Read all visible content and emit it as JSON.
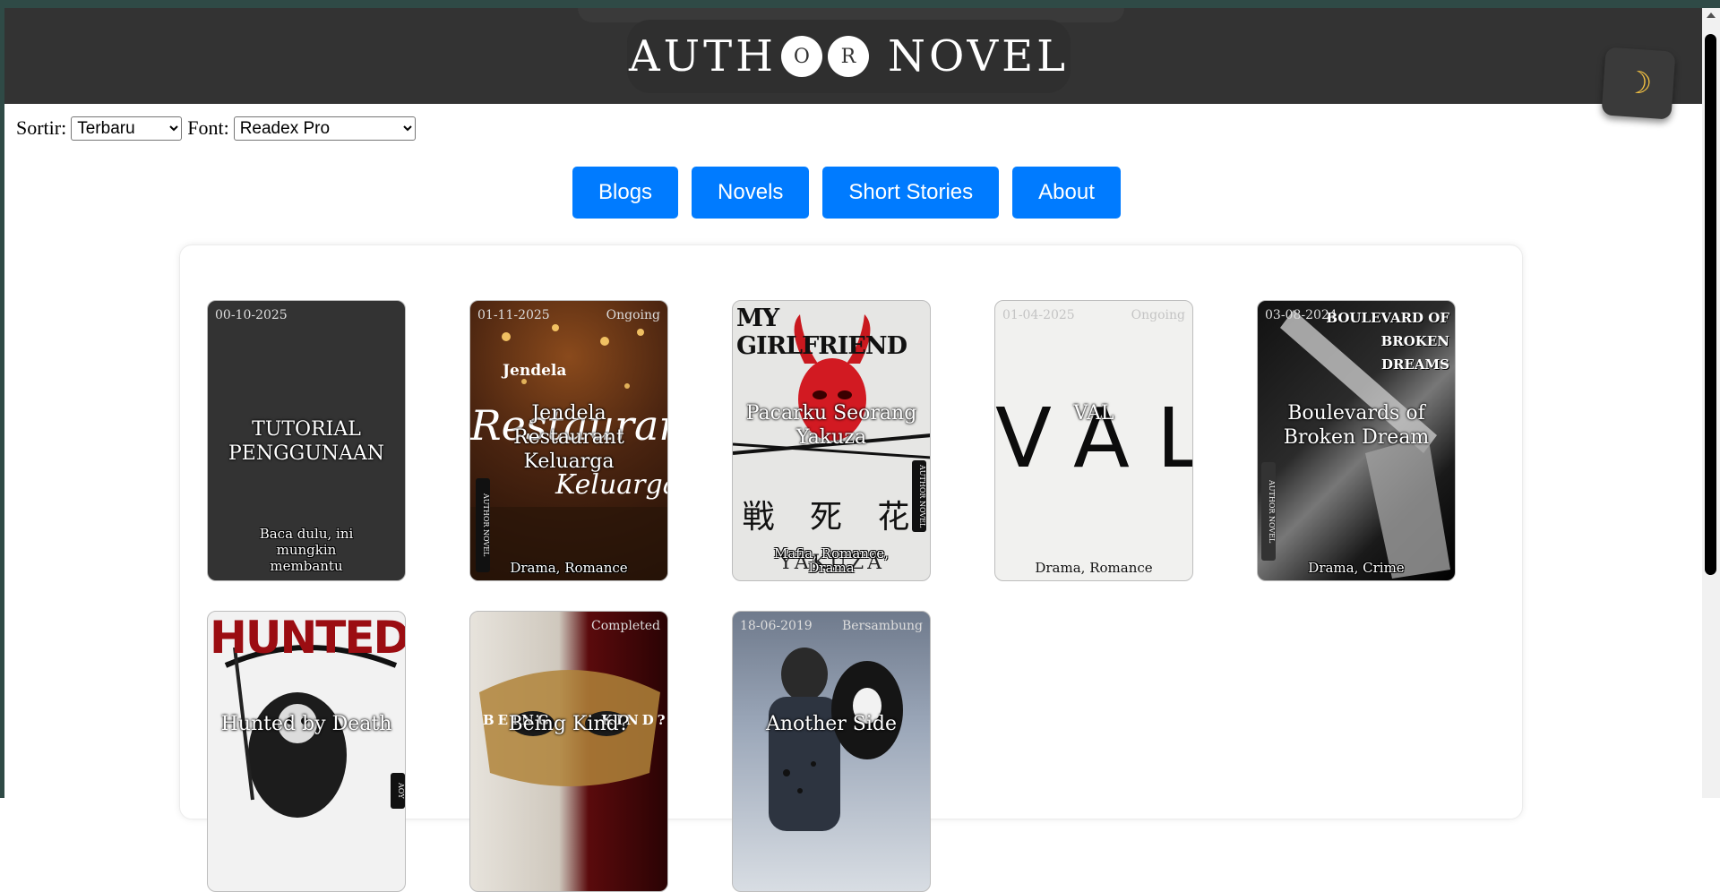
{
  "header": {
    "logo_parts": [
      "AUTH",
      "O",
      "R",
      "NOVEL"
    ],
    "theme_icon": "moon-icon"
  },
  "controls": {
    "sort_label": "Sortir:",
    "sort_value": "Terbaru",
    "font_label": "Font:",
    "font_value": "Readex Pro"
  },
  "nav": [
    "Blogs",
    "Novels",
    "Short Stories",
    "About"
  ],
  "cards": [
    {
      "date": "00-10-2025",
      "status": "",
      "title": "TUTORIAL PENGGUNAAN",
      "genre": "",
      "desc": "Baca dulu, ini mungkin membantu"
    },
    {
      "date": "01-11-2025",
      "status": "Ongoing",
      "title": "Jendela Restaurant Keluarga",
      "genre": "Drama, Romance",
      "desc": "",
      "cover_heading": "Jendela",
      "cover_script": "Restaurant",
      "cover_script2": "Keluarga"
    },
    {
      "date": "",
      "status": "",
      "title": "Pacarku Seorang Yakuza",
      "genre": "Mafia, Romance, Drama",
      "desc": "",
      "cover_heading": "MY GIRLFRIEND",
      "cover_kanji": "戦 死 花",
      "cover_bottom": "YAKUZA"
    },
    {
      "date": "01-04-2025",
      "status": "Ongoing",
      "title": "VAL",
      "genre": "Drama, Romance",
      "desc": "",
      "cover_word": "VAL"
    },
    {
      "date": "03-08-2024",
      "status": "",
      "title": "Boulevards of Broken Dream",
      "genre": "Drama, Crime",
      "desc": "",
      "cover_heading": "BOULEVARD OF BROKEN DREAMS"
    },
    {
      "date": "",
      "status": "",
      "title": "Hunted by Death",
      "genre": "",
      "desc": "",
      "cover_heading": "HUNTED"
    },
    {
      "date": "",
      "status": "Completed",
      "title": "Being Kind?",
      "genre": "",
      "desc": "",
      "cover_left": "BEING",
      "cover_right": "KIND?"
    },
    {
      "date": "18-06-2019",
      "status": "Bersambung",
      "title": "Another Side",
      "genre": "",
      "desc": ""
    }
  ],
  "colors": {
    "header_bg": "#333333",
    "nav_button": "#007bff",
    "card_dark": "#333333"
  }
}
